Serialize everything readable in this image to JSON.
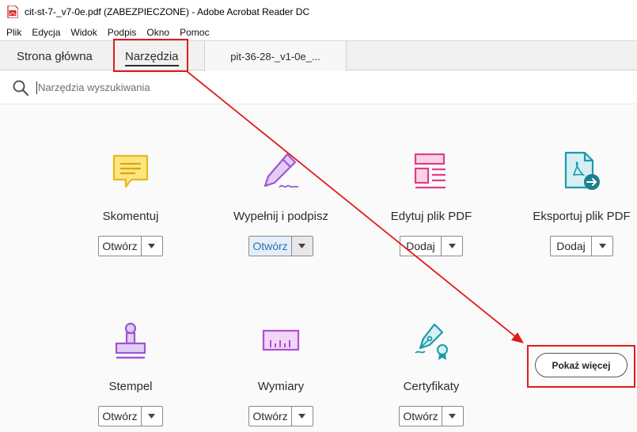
{
  "window": {
    "title": "cit-st-7-_v7-0e.pdf (ZABEZPIECZONE) - Adobe Acrobat Reader DC",
    "app_icon": "acrobat-pdf-icon"
  },
  "menu": [
    "Plik",
    "Edycja",
    "Widok",
    "Podpis",
    "Okno",
    "Pomoc"
  ],
  "tabs": {
    "home": "Strona główna",
    "tools": "Narzędzia",
    "document": "pit-36-28-_v1-0e_..."
  },
  "search": {
    "placeholder": "Narzędzia wyszukiwania",
    "icon": "search-icon"
  },
  "tools": [
    {
      "label": "Skomentuj",
      "button": "Otwórz",
      "icon": "comment-icon",
      "color": "#e8c23a"
    },
    {
      "label": "Wypełnij i podpisz",
      "button": "Otwórz",
      "icon": "fill-sign-icon",
      "color": "#9b57d3",
      "active": true
    },
    {
      "label": "Edytuj plik PDF",
      "button": "Dodaj",
      "icon": "edit-pdf-icon",
      "color": "#e03c8c"
    },
    {
      "label": "Eksportuj plik PDF",
      "button": "Dodaj",
      "icon": "export-pdf-icon",
      "color": "#1b9bab"
    },
    {
      "label": "Stempel",
      "button": "Otwórz",
      "icon": "stamp-icon",
      "color": "#9b57d3"
    },
    {
      "label": "Wymiary",
      "button": "Otwórz",
      "icon": "measure-icon",
      "color": "#b24fd0"
    },
    {
      "label": "Certyfikaty",
      "button": "Otwórz",
      "icon": "certificate-icon",
      "color": "#1b9bab"
    }
  ],
  "show_more": "Pokaż więcej",
  "annotation_color": "#e01b1b"
}
